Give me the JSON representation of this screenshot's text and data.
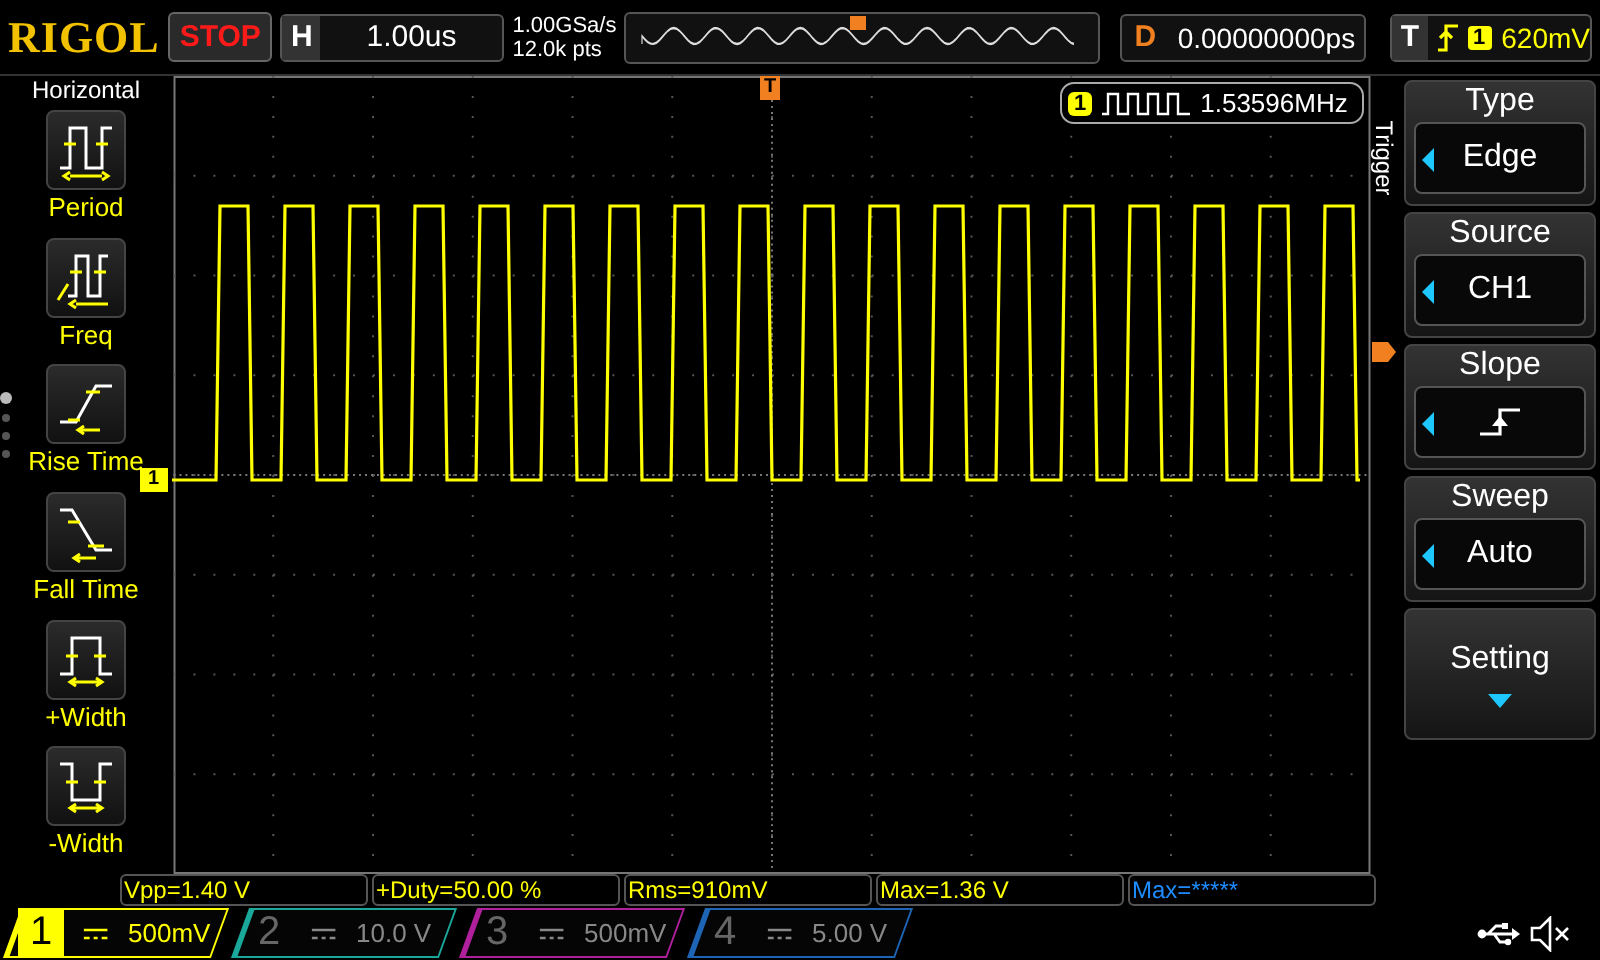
{
  "top_bar": {
    "logo": "RIGOL",
    "run_state": {
      "label": "STOP",
      "running": false
    },
    "horizontal": {
      "label": "H",
      "value": "1.00us"
    },
    "sample_rate": "1.00GSa/s",
    "memory_depth": "12.0k pts",
    "delay": {
      "label": "D",
      "value": "0.00000000ps"
    },
    "trigger": {
      "label": "T",
      "channel": "1",
      "level": "620mV"
    }
  },
  "left_menu": {
    "title": "Horizontal",
    "items": [
      {
        "kind": "period",
        "label": "Period"
      },
      {
        "kind": "freq",
        "label": "Freq"
      },
      {
        "kind": "rise",
        "label": "Rise Time"
      },
      {
        "kind": "fall",
        "label": "Fall Time"
      },
      {
        "kind": "pwidth",
        "label": "+Width"
      },
      {
        "kind": "nwidth",
        "label": "-Width"
      }
    ],
    "pages": [
      {
        "selected": true
      },
      {
        "selected": false
      },
      {
        "selected": false
      },
      {
        "selected": false
      }
    ]
  },
  "scope": {
    "trigger_marker": "T",
    "channel_marker": "1",
    "frequency": {
      "channel": "1",
      "value": "1.53596MHz"
    }
  },
  "trigger_menu": {
    "title": "Trigger",
    "items": [
      {
        "kind": "value",
        "label": "Type",
        "value": "Edge"
      },
      {
        "kind": "value",
        "label": "Source",
        "value": "CH1"
      },
      {
        "kind": "slope",
        "label": "Slope"
      },
      {
        "kind": "value",
        "label": "Sweep",
        "value": "Auto"
      },
      {
        "kind": "more",
        "label": "Setting"
      }
    ]
  },
  "measurements": [
    {
      "text": "Vpp=1.40 V",
      "color": "#ffff00"
    },
    {
      "text": "+Duty=50.00 %",
      "color": "#ffff00"
    },
    {
      "text": "Rms=910mV",
      "color": "#ffff00"
    },
    {
      "text": "Max=1.36 V",
      "color": "#ffff00"
    },
    {
      "text": "Max=*****",
      "color": "#1e8cff"
    }
  ],
  "channels": [
    {
      "number": "1",
      "scale": "500mV",
      "on": true,
      "color": "#ffff00"
    },
    {
      "number": "2",
      "scale": "10.0 V",
      "on": false,
      "color": "#1aa89a"
    },
    {
      "number": "3",
      "scale": "500mV",
      "on": false,
      "color": "#b0209c"
    },
    {
      "number": "4",
      "scale": "5.00 V",
      "on": false,
      "color": "#1e64b4"
    }
  ]
}
